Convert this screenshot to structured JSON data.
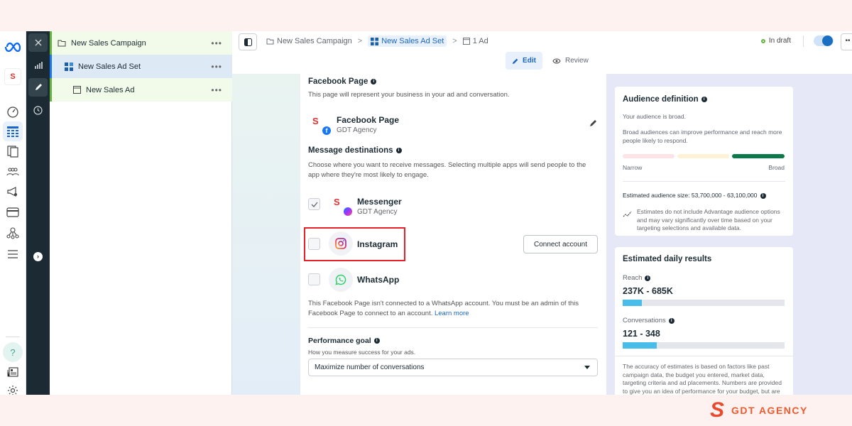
{
  "tree": {
    "campaign": "New Sales Campaign",
    "ad_set": "New Sales Ad Set",
    "ad": "New Sales Ad",
    "more": "•••"
  },
  "breadcrumb": {
    "campaign": "New Sales Campaign",
    "ad_set": "New Sales Ad Set",
    "ads": "1 Ad",
    "separator": ">"
  },
  "header": {
    "status": "In draft",
    "more": "••",
    "toggle_on": true
  },
  "modes": {
    "edit": "Edit",
    "review": "Review"
  },
  "form": {
    "fb_page_heading": "Facebook Page",
    "fb_page_desc": "This page will represent your business in your ad and conversation.",
    "page_name": "Facebook Page",
    "page_sub": "GDT Agency",
    "msg_heading": "Message destinations",
    "msg_desc": "Choose where you want to receive messages. Selecting multiple apps will send people to the app where they're most likely to engage.",
    "destinations": [
      {
        "name": "Messenger",
        "sub": "GDT Agency",
        "checked": true
      },
      {
        "name": "Instagram",
        "checked": false,
        "action": "Connect account"
      },
      {
        "name": "WhatsApp",
        "checked": false
      }
    ],
    "whatsapp_note": "This Facebook Page isn't connected to a WhatsApp account. You must be an admin of this Facebook Page to connect to an account.",
    "learn_more": "Learn more",
    "perf_heading": "Performance goal",
    "perf_desc": "How you measure success for your ads.",
    "perf_value": "Maximize number of conversations"
  },
  "audience": {
    "title": "Audience definition",
    "status": "Your audience is broad.",
    "desc": "Broad audiences can improve performance and reach more people likely to respond.",
    "narrow": "Narrow",
    "broad": "Broad",
    "size": "Estimated audience size: 53,700,000 - 63,100,000",
    "note": "Estimates do not include Advantage audience options and may vary significantly over time based on your targeting selections and available data.",
    "colors": {
      "narrow": "#fde3e6",
      "mid": "#fdf1d6",
      "broad": "#0a7a4a"
    }
  },
  "daily": {
    "title": "Estimated daily results",
    "reach_label": "Reach",
    "reach_value": "237K - 685K",
    "reach_fill": 0.12,
    "conv_label": "Conversations",
    "conv_value": "121 - 348",
    "conv_fill": 0.21,
    "accuracy": "The accuracy of estimates is based on factors like past campaign data, the budget you entered, market data, targeting criteria and ad placements. Numbers are provided to give you an idea of performance for your budget, but are"
  },
  "footer": {
    "brand": "GDT AGENCY",
    "logo": "S"
  }
}
